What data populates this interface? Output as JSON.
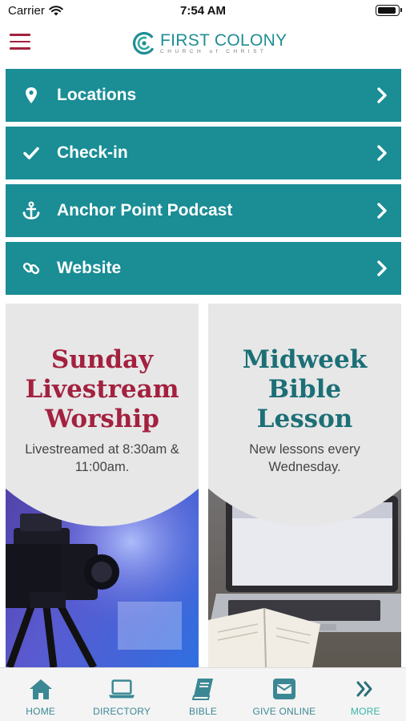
{
  "status_bar": {
    "carrier": "Carrier",
    "time": "7:54 AM"
  },
  "header": {
    "logo_title": "FIRST COLONY",
    "logo_subtitle": "CHURCH of CHRIST",
    "logo_icon": "first-colony-c-logo",
    "menu_icon": "hamburger-icon"
  },
  "menu": {
    "items": [
      {
        "label": "Locations",
        "icon": "location-pin-icon"
      },
      {
        "label": "Check-in",
        "icon": "checkmark-icon"
      },
      {
        "label": "Anchor Point Podcast",
        "icon": "anchor-icon"
      },
      {
        "label": "Website",
        "icon": "link-icon"
      }
    ]
  },
  "cards": [
    {
      "title_lines": [
        "Sunday",
        "Livestream",
        "Worship"
      ],
      "subtitle_lines": [
        "Livestreamed at 8:30am &",
        "11:00am."
      ]
    },
    {
      "title_lines": [
        "Midweek",
        "Bible",
        "Lesson"
      ],
      "subtitle_lines": [
        "New lessons every",
        "Wednesday."
      ]
    }
  ],
  "tabs": [
    {
      "label": "HOME",
      "icon": "home-icon"
    },
    {
      "label": "DIRECTORY",
      "icon": "laptop-icon"
    },
    {
      "label": "BIBLE",
      "icon": "book-icon"
    },
    {
      "label": "GIVE ONLINE",
      "icon": "envelope-icon"
    },
    {
      "label": "MORE",
      "icon": "double-chevron-icon"
    }
  ],
  "colors": {
    "teal": "#1a8d95",
    "crimson": "#a3213f",
    "dark_teal": "#1c6f76",
    "tab_icon": "#3b8894",
    "tab_more": "#35b5a8"
  }
}
